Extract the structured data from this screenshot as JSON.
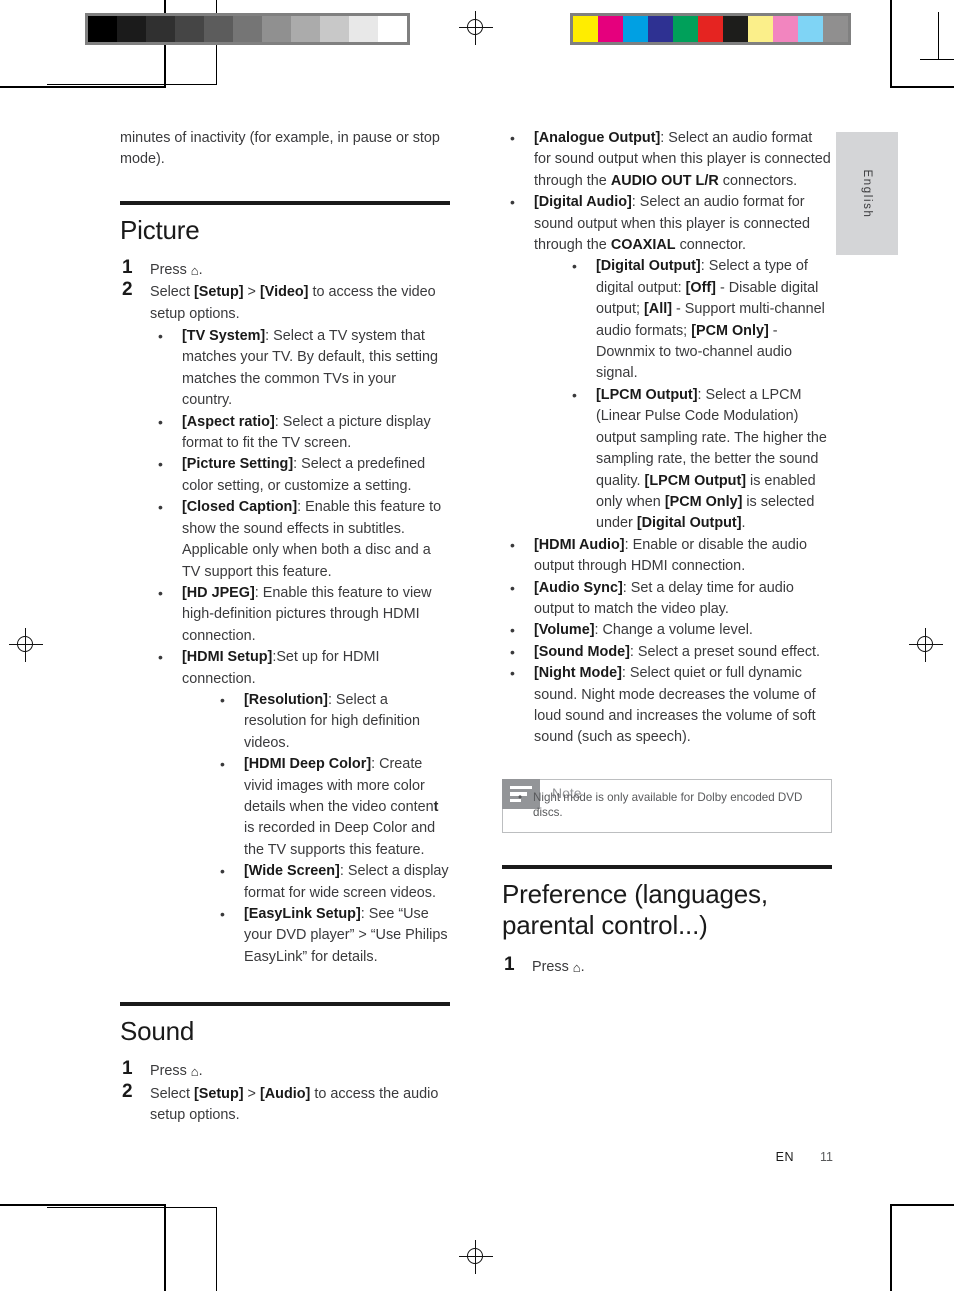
{
  "document": {
    "footer": {
      "locale_code": "EN",
      "page_number": "11"
    },
    "side_tab": {
      "language": "English"
    }
  },
  "calibration": {
    "grayscale_swatches": [
      "#000000",
      "#1b1b1b",
      "#303030",
      "#454545",
      "#5c5c5c",
      "#757575",
      "#909090",
      "#ababab",
      "#c8c8c8",
      "#e8e8e8",
      "#ffffff"
    ],
    "color_swatches": [
      "#ffed00",
      "#e5007d",
      "#00a0e3",
      "#2e3192",
      "#00a05a",
      "#e52421",
      "#1d1d1b",
      "#fbef8a",
      "#f285bf",
      "#7fd4f5",
      "#908f8f"
    ]
  },
  "left_column": {
    "continued_paragraph": "minutes of inactivity (for example, in pause or stop mode).",
    "sections": [
      {
        "title": "Picture",
        "steps": [
          {
            "num": "1",
            "text_before": "Press ",
            "icon": "home-icon",
            "text_after": "."
          },
          {
            "num": "2",
            "text": "Select [Setup] > [Video] to access the video setup options."
          }
        ],
        "bullets": [
          {
            "term": "[TV System]",
            "desc": ": Select a TV system that matches your TV. By default, this setting matches the common TVs in your country."
          },
          {
            "term": "[Aspect ratio]",
            "desc": ": Select a picture display format to fit the TV screen."
          },
          {
            "term": "[Picture Setting]",
            "desc": ": Select a predefined color setting, or customize a setting."
          },
          {
            "term": "[Closed Caption]",
            "desc": ": Enable this feature to show the sound effects in subtitles. Applicable only when both a disc and a TV support this feature."
          },
          {
            "term": "[HD JPEG]",
            "desc": ": Enable this feature to view high-definition pictures through HDMI connection."
          },
          {
            "term": "[HDMI Setup]",
            "desc": ":Set up for HDMI connection.",
            "subbullets": [
              {
                "term": "[Resolution]",
                "desc": ": Select a resolution for high definition videos."
              },
              {
                "term": "[HDMI Deep Color]",
                "desc_a": ": Create vivid images with more color details when the video conten",
                "desc_odd": "t",
                "desc_b": " is recorded in Deep Color and the TV supports this feature."
              },
              {
                "term": "[Wide Screen]",
                "desc": ": Select a display format for wide screen videos."
              },
              {
                "term": "[EasyLink Setup]",
                "desc": ": See “Use your DVD player” > “Use Philips EasyLink” for details."
              }
            ]
          }
        ]
      },
      {
        "title": "Sound",
        "steps": [
          {
            "num": "1",
            "text_before": "Press ",
            "icon": "home-icon",
            "text_after": "."
          },
          {
            "num": "2",
            "text": "Select [Setup] > [Audio] to access the audio setup options."
          }
        ]
      }
    ]
  },
  "right_column": {
    "bullets": [
      {
        "term": "[Analogue Output]",
        "desc_a": ": Select an audio format for sound output when this player is connected through the ",
        "caps": "AUDIO OUT L/R",
        "desc_b": " connectors."
      },
      {
        "term": "[Digital Audio]",
        "desc_a": ": Select an audio format for sound output when this player is connected through the ",
        "caps": "COAXIAL",
        "desc_b": " connector.",
        "subbullets": [
          {
            "term": "[Digital Output]",
            "segments": ": Select a type of digital output: [Off] - Disable digital output; [All] - Support multi-channel audio formats; [PCM Only] - Downmix to two-channel audio signal."
          },
          {
            "term": "[LPCM Output]",
            "segments": ": Select a LPCM (Linear Pulse Code Modulation) output sampling rate. The higher the sampling rate, the better the sound quality. [LPCM Output] is enabled only when [PCM Only] is selected under [Digital Output]."
          }
        ]
      },
      {
        "term": "[HDMI Audio]",
        "desc": ": Enable or disable the audio output through HDMI connection."
      },
      {
        "term": "[Audio Sync]",
        "desc": ": Set a delay time for audio output to match the video play."
      },
      {
        "term": "[Volume]",
        "desc": ": Change a volume level."
      },
      {
        "term": "[Sound Mode]",
        "desc": ": Select a preset sound effect."
      },
      {
        "term": "[Night Mode]",
        "desc": ": Select quiet or full dynamic sound. Night mode decreases the volume of loud sound and increases the volume of soft sound (such as speech)."
      }
    ],
    "note": {
      "icon": "note-lines-icon",
      "title": "Note",
      "items": [
        "Night mode is only available for Dolby encoded DVD discs."
      ]
    },
    "section": {
      "title": "Preference (languages, parental control...)",
      "steps": [
        {
          "num": "1",
          "text_before": "Press ",
          "icon": "home-icon",
          "text_after": "."
        }
      ]
    }
  }
}
